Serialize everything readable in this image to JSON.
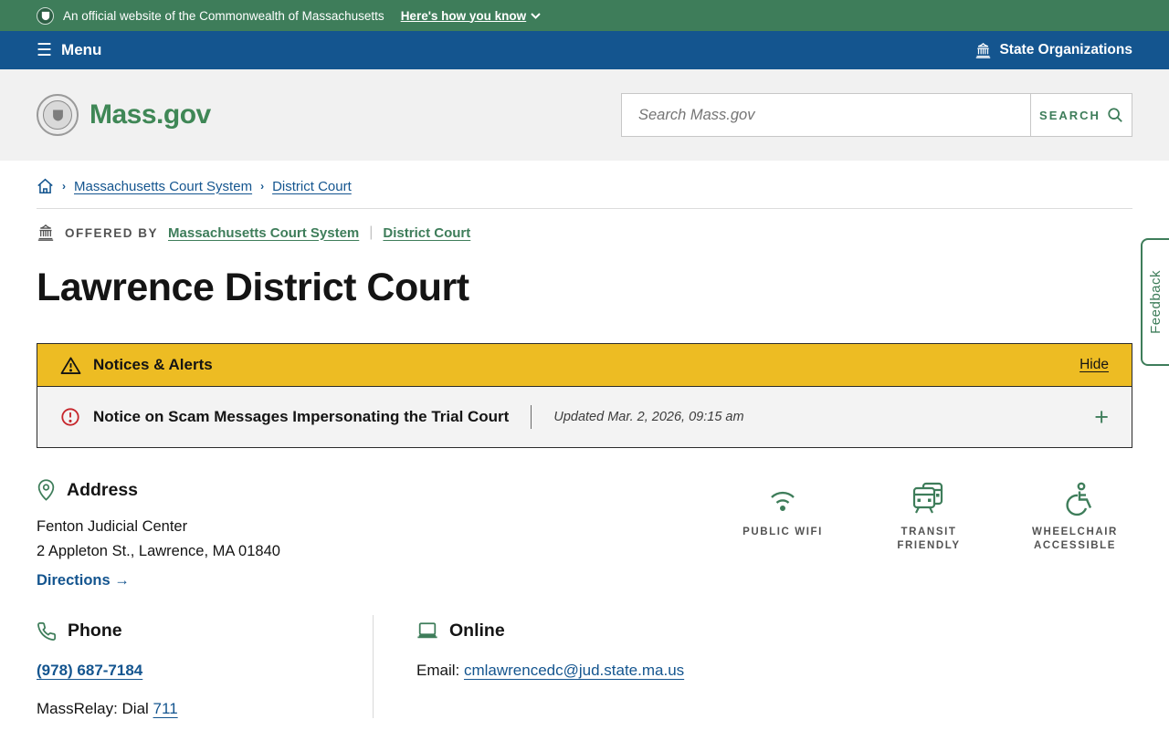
{
  "colors": {
    "banner_green": "#3e7d5a",
    "bar_blue": "#14558f",
    "brand_green": "#3f8756",
    "alert_yellow": "#edbc23",
    "alert_red": "#c6252b",
    "link_blue": "#14558f",
    "header_gray": "#f1f1f1",
    "notice_gray": "#f3f3f3"
  },
  "banner": {
    "text": "An official website of the Commonwealth of Massachusetts",
    "how_you_know": "Here's how you know"
  },
  "menubar": {
    "menu_label": "Menu",
    "state_organizations_label": "State Organizations"
  },
  "header": {
    "logo_text": "Mass.gov",
    "search_placeholder": "Search Mass.gov",
    "search_button_label": "SEARCH"
  },
  "breadcrumb": {
    "items": [
      {
        "label": "Massachusetts Court System"
      },
      {
        "label": "District Court"
      }
    ]
  },
  "offered_by": {
    "label": "OFFERED BY",
    "links": [
      {
        "label": "Massachusetts Court System"
      },
      {
        "label": "District Court"
      }
    ]
  },
  "page": {
    "title": "Lawrence District Court"
  },
  "alerts": {
    "header_title": "Notices & Alerts",
    "hide_label": "Hide",
    "notice_title": "Notice on Scam Messages Impersonating the Trial Court",
    "notice_updated": "Updated Mar. 2, 2026, 09:15 am",
    "expand_label": "+"
  },
  "address": {
    "heading": "Address",
    "line1": "Fenton Judicial Center",
    "line2": "2 Appleton St., Lawrence, MA 01840",
    "directions_label": "Directions →"
  },
  "amenities": [
    {
      "icon": "wifi-icon",
      "label": "PUBLIC WIFI"
    },
    {
      "icon": "transit-icon",
      "label": "TRANSIT FRIENDLY"
    },
    {
      "icon": "wheelchair-icon",
      "label": "WHEELCHAIR ACCESSIBLE"
    }
  ],
  "phone": {
    "heading": "Phone",
    "number": "(978) 687-7184",
    "massrelay_prefix": "MassRelay: Dial ",
    "massrelay_number": "711"
  },
  "online": {
    "heading": "Online",
    "email_label": "Email: ",
    "email": "cmlawrencedc@jud.state.ma.us"
  },
  "feedback": {
    "label": "Feedback"
  }
}
